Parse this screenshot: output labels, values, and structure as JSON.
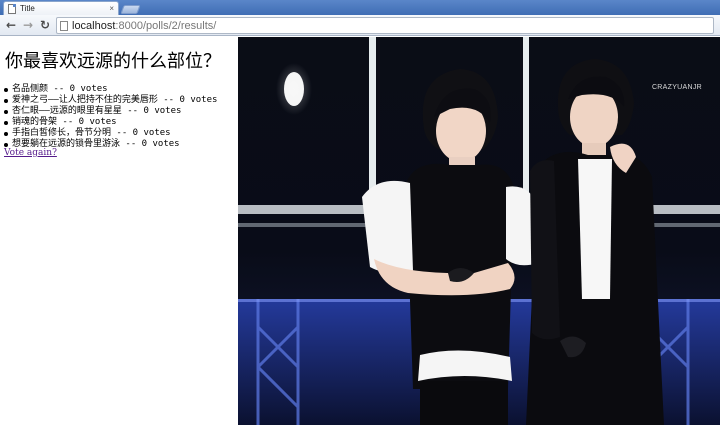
{
  "browser": {
    "tab_title": "Title",
    "tab_close": "×",
    "url_host": "localhost",
    "url_path": ":8000/polls/2/results/",
    "back_glyph": "←",
    "forward_glyph": "→",
    "reload_glyph": "↻",
    "icons": [
      "page-icon",
      "back-icon",
      "forward-icon",
      "reload-icon",
      "close-icon"
    ]
  },
  "poll": {
    "question": "你最喜欢远源的什么部位？",
    "choices": [
      {
        "text": "名品侧颜 -- 0 votes"
      },
      {
        "text": "爱神之弓——让人把持不住的完美唇形 -- 0 votes"
      },
      {
        "text": "杏仁眼——远源的眼里有星星 -- 0 votes"
      },
      {
        "text": "销魂的骨架 -- 0 votes"
      },
      {
        "text": "手指白皙修长，骨节分明 -- 0 votes"
      },
      {
        "text": "想要躺在远源的锁骨里游泳 -- 0 votes"
      }
    ],
    "vote_again": "Vote again?"
  },
  "photo": {
    "watermark": "CRAZYUANJR",
    "subject": "two performers on stage in black outfits",
    "colors": {
      "stage_dark": "#05070f",
      "stage_blue": "#2a3f9a",
      "light_bar": "#e9eef0"
    }
  }
}
